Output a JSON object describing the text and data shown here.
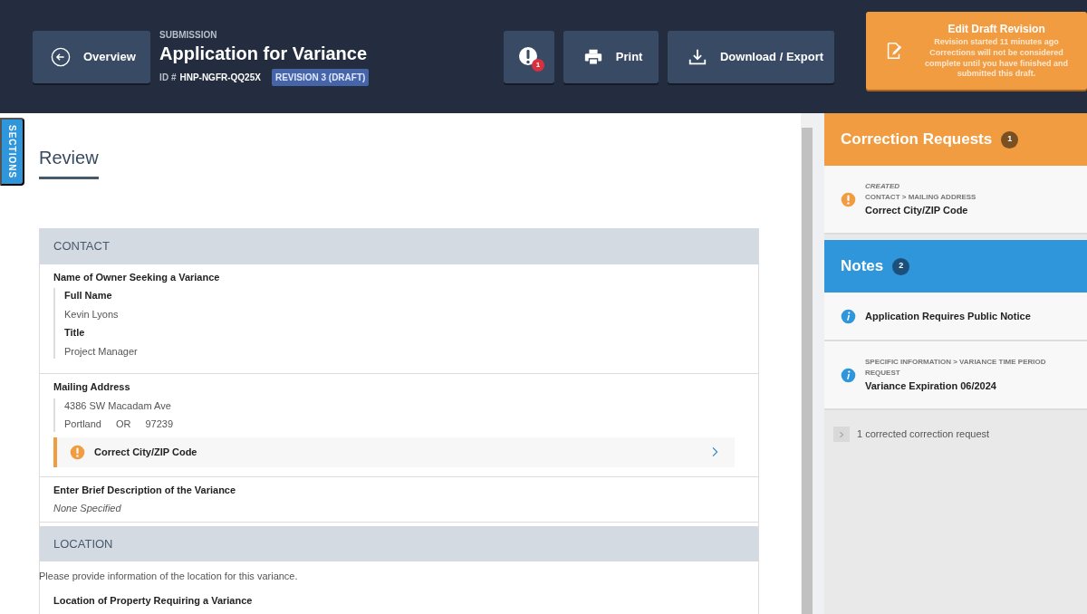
{
  "header": {
    "back_button": "Overview",
    "kicker": "SUBMISSION",
    "title": "Application for Variance",
    "id_label": "ID #",
    "id": "HNP-NGFR-QQ25X",
    "revision_badge": "REVISION 3 (DRAFT)",
    "alerts_button": {
      "count": "1"
    },
    "buttons": [
      {
        "kind": "print",
        "label": "Print"
      },
      {
        "kind": "download",
        "label": "Download / Export"
      }
    ],
    "edit_draft": {
      "title": "Edit Draft Revision",
      "message": "Revision started 11 minutes ago Corrections will not be considered complete until you have finished and submitted this draft."
    }
  },
  "sections_tab": "SECTIONS",
  "page_title": "Review",
  "sections": [
    {
      "heading": "CONTACT",
      "fields": [
        {
          "kind": "group",
          "label": "Name of Owner Seeking a Variance",
          "subfields": [
            {
              "label": "Full Name",
              "value": "Kevin Lyons"
            },
            {
              "label": "Title",
              "value": "Project Manager"
            }
          ]
        },
        {
          "kind": "address",
          "label": "Mailing Address",
          "street": "4386 SW Macadam Ave",
          "city": "Portland",
          "state": "OR",
          "zip": "97239",
          "correction": "Correct City/ZIP Code"
        },
        {
          "kind": "empty",
          "label": "Enter Brief Description of the Variance",
          "value": "None Specified"
        }
      ]
    },
    {
      "heading": "LOCATION",
      "intro": "Please provide information of the location for this variance.",
      "fields": [
        {
          "kind": "label",
          "label": "Location of Property Requiring a Variance"
        }
      ]
    }
  ],
  "correction_requests": {
    "title": "Correction Requests",
    "count": "1",
    "items": [
      {
        "status": "CREATED",
        "path": "CONTACT > MAILING ADDRESS",
        "text": "Correct City/ZIP Code"
      }
    ]
  },
  "notes": {
    "title": "Notes",
    "count": "2",
    "items": [
      {
        "text": "Application Requires Public Notice"
      },
      {
        "path": "SPECIFIC INFORMATION > VARIANCE TIME PERIOD REQUEST",
        "text": "Variance Expiration 06/2024"
      }
    ]
  },
  "corrected_toggle": {
    "label": "1 corrected correction request",
    "expanded": false
  }
}
